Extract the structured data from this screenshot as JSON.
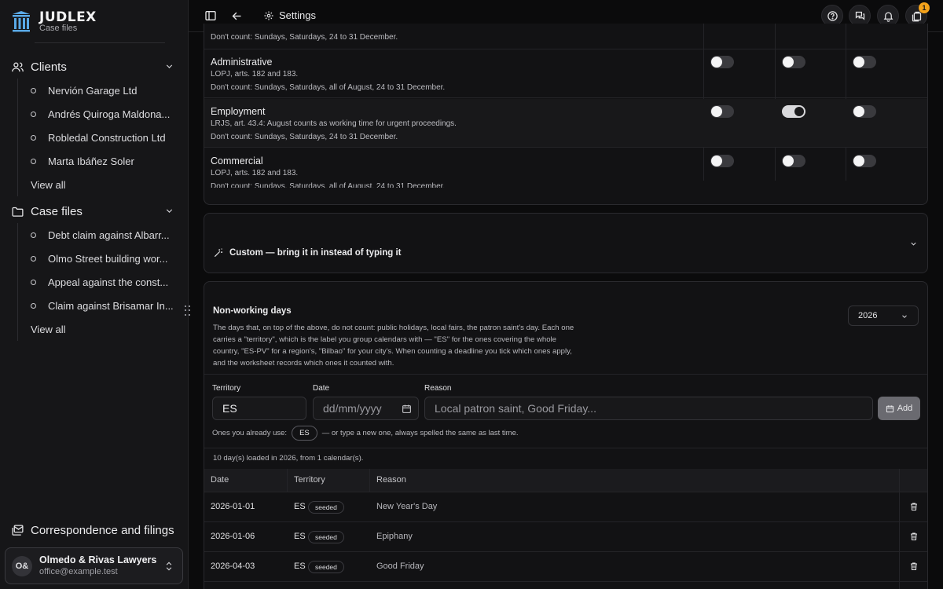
{
  "brand": {
    "name": "JUDLEX",
    "subtitle": "Case files"
  },
  "sidebar": {
    "clients": {
      "label": "Clients",
      "items": [
        "Nervión Garage Ltd",
        "Andrés Quiroga Maldona...",
        "Robledal Construction Ltd",
        "Marta Ibáñez Soler"
      ],
      "view_all": "View all"
    },
    "case_files": {
      "label": "Case files",
      "items": [
        "Debt claim against Albarr...",
        "Olmo Street building wor...",
        "Appeal against the const...",
        "Claim against Brisamar In..."
      ],
      "view_all": "View all"
    },
    "correspondence": "Correspondence and filings",
    "account": {
      "initials": "O&",
      "name": "Olmedo & Rivas Lawyers",
      "email": "office@example.test"
    }
  },
  "topbar": {
    "settings_label": "Settings",
    "notifications_badge": "1"
  },
  "jurisdictions": {
    "partial_note": "Don't count: Sundays, Saturdays, 24 to 31 December.",
    "rows": [
      {
        "name": "Administrative",
        "note1": "LOPJ, arts. 182 and 183.",
        "note2": "Don't count: Sundays, Saturdays, all of August, 24 to 31 December.",
        "toggles": [
          false,
          false,
          false
        ]
      },
      {
        "name": "Employment",
        "note1": "LRJS, art. 43.4: August counts as working time for urgent proceedings.",
        "note2": "Don't count: Sundays, Saturdays, 24 to 31 December.",
        "toggles": [
          false,
          true,
          false
        ]
      },
      {
        "name": "Commercial",
        "note1": "LOPJ, arts. 182 and 183.",
        "note2": "Don't count: Sundays, Saturdays, all of August, 24 to 31 December.",
        "toggles": [
          false,
          false,
          false
        ]
      }
    ]
  },
  "custom": {
    "label": "Custom — bring it in instead of typing it"
  },
  "non_working": {
    "title": "Non-working days",
    "description": "The days that, on top of the above, do not count: public holidays, local fairs, the patron saint's day. Each one carries a \"territory\", which is the label you group calendars with — \"ES\" for the ones covering the whole country, \"ES-PV\" for a region's, \"Bilbao\" for your city's. When counting a deadline you tick which ones apply, and the worksheet records which ones it counted with.",
    "year": "2026",
    "form": {
      "territory_label": "Territory",
      "territory_value": "ES",
      "date_label": "Date",
      "date_placeholder": "dd/mm/yyyy",
      "reason_label": "Reason",
      "reason_placeholder": "Local patron saint, Good Friday...",
      "add_label": "Add"
    },
    "used_prefix": "Ones you already use:",
    "used_chip": "ES",
    "used_suffix": "— or type a new one, always spelled the same as last time.",
    "loaded_text": "10 day(s) loaded in 2026, from 1 calendar(s).",
    "table": {
      "headers": [
        "Date",
        "Territory",
        "Reason"
      ],
      "rows": [
        {
          "date": "2026-01-01",
          "territory": "ES",
          "badge": "seeded",
          "reason": "New Year's Day"
        },
        {
          "date": "2026-01-06",
          "territory": "ES",
          "badge": "seeded",
          "reason": "Epiphany"
        },
        {
          "date": "2026-04-03",
          "territory": "ES",
          "badge": "seeded",
          "reason": "Good Friday"
        }
      ]
    }
  }
}
